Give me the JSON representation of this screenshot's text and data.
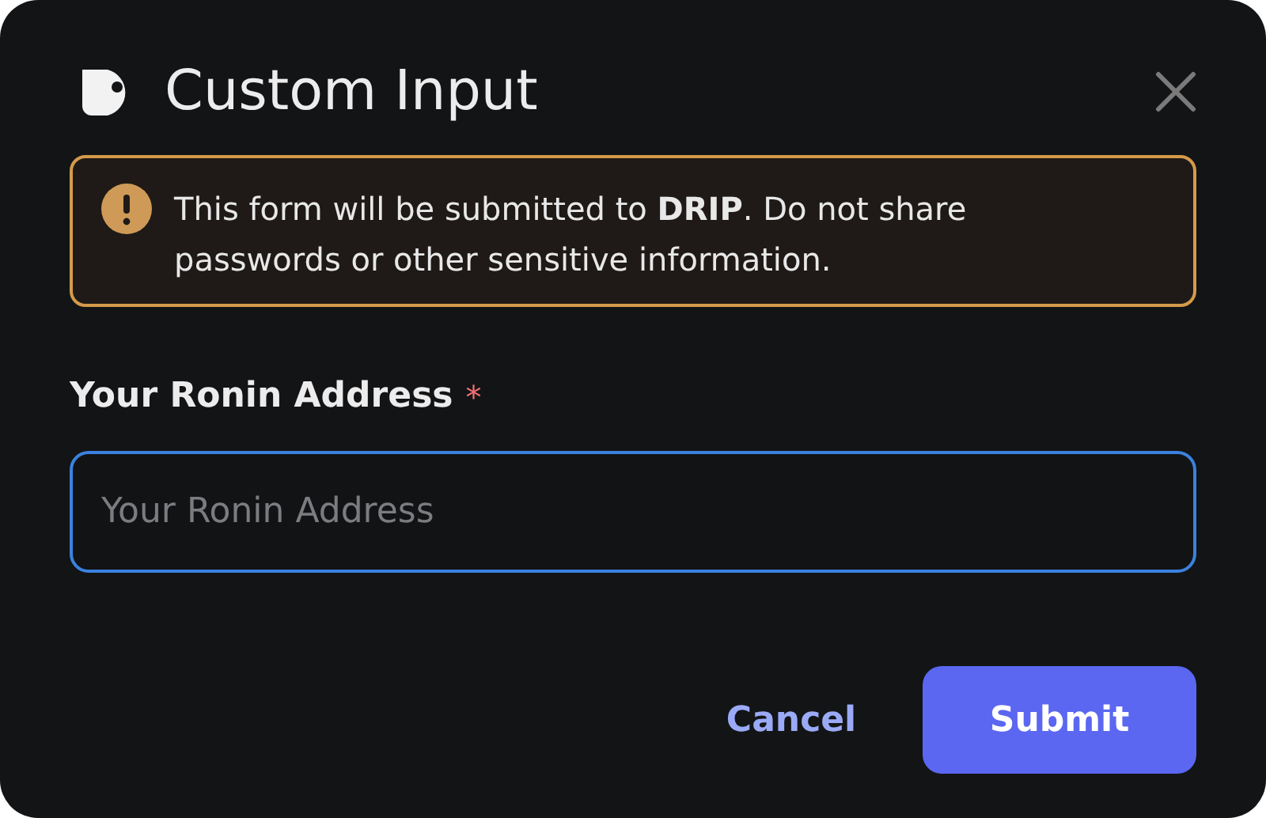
{
  "dialog": {
    "title": "Custom Input"
  },
  "warning": {
    "text": "This form will be submitted to **DRIP**. Do not share passwords or other sensitive information."
  },
  "field": {
    "label": "Your Ronin Address",
    "required_mark": "*",
    "placeholder": "Your Ronin Address",
    "focused": true
  },
  "buttons": [
    {
      "label": "Cancel",
      "kind": "secondary"
    },
    {
      "label": "Submit",
      "kind": "primary"
    }
  ]
}
